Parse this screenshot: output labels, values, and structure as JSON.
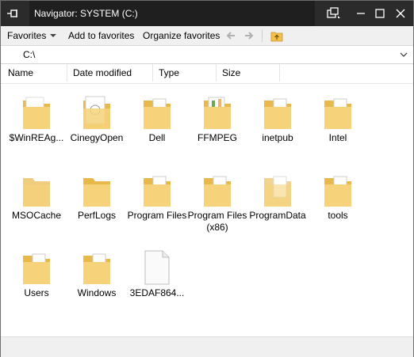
{
  "window": {
    "title": "Navigator: SYSTEM (C:)"
  },
  "toolbar": {
    "favorites_label": "Favorites",
    "add_favorites_label": "Add to favorites",
    "organize_favorites_label": "Organize favorites"
  },
  "address": {
    "path": "C:\\"
  },
  "columns": [
    "Name",
    "Date modified",
    "Type",
    "Size"
  ],
  "items": [
    {
      "label": "$WinREAg...",
      "icon": "folder-icon"
    },
    {
      "label": "CinegyOpen",
      "icon": "folder-icon"
    },
    {
      "label": "Dell",
      "icon": "folder-icon"
    },
    {
      "label": "FFMPEG",
      "icon": "folder-icon"
    },
    {
      "label": "inetpub",
      "icon": "folder-icon"
    },
    {
      "label": "Intel",
      "icon": "folder-icon"
    },
    {
      "label": "MSOCache",
      "icon": "folder-icon"
    },
    {
      "label": "PerfLogs",
      "icon": "folder-icon"
    },
    {
      "label": "Program Files",
      "icon": "folder-icon"
    },
    {
      "label": "Program Files (x86)",
      "icon": "folder-icon"
    },
    {
      "label": "ProgramData",
      "icon": "folder-icon"
    },
    {
      "label": "tools",
      "icon": "folder-icon"
    },
    {
      "label": "Users",
      "icon": "folder-icon"
    },
    {
      "label": "Windows",
      "icon": "folder-icon"
    },
    {
      "label": "3EDAF864...",
      "icon": "file-icon"
    }
  ],
  "colors": {
    "titlebar": "#2b2b2b",
    "folder": "#f6d27a",
    "folder_dark": "#e8b84a",
    "accent": "#f2c14e"
  }
}
